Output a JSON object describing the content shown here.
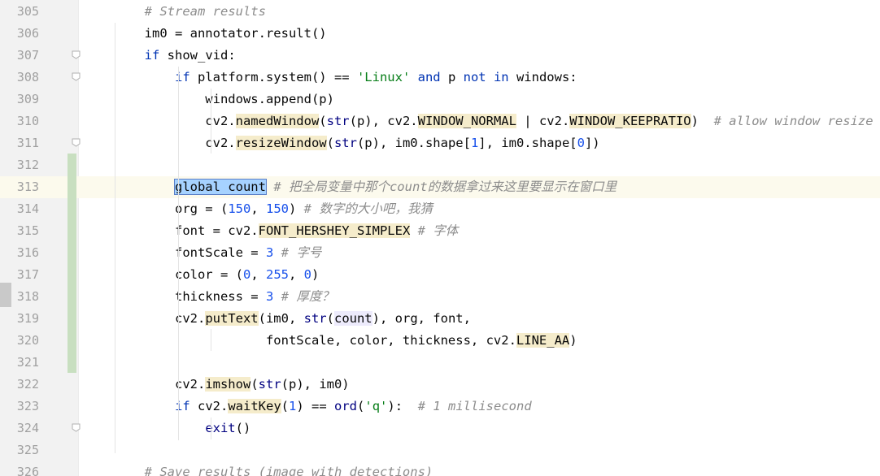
{
  "editor": {
    "lines": [
      {
        "n": "305",
        "segs": [
          {
            "t": "        "
          },
          {
            "t": "# Stream results",
            "c": "cm"
          }
        ]
      },
      {
        "n": "306",
        "segs": [
          {
            "t": "        im0 = annotator.result()"
          }
        ]
      },
      {
        "n": "307",
        "segs": [
          {
            "t": "        "
          },
          {
            "t": "if",
            "c": "kw"
          },
          {
            "t": " show_vid:"
          }
        ]
      },
      {
        "n": "308",
        "segs": [
          {
            "t": "            "
          },
          {
            "t": "if",
            "c": "kw"
          },
          {
            "t": " platform.system() == "
          },
          {
            "t": "'Linux'",
            "c": "str"
          },
          {
            "t": " "
          },
          {
            "t": "and",
            "c": "kw"
          },
          {
            "t": " p "
          },
          {
            "t": "not in",
            "c": "kw"
          },
          {
            "t": " windows:"
          }
        ]
      },
      {
        "n": "309",
        "segs": [
          {
            "t": "                windows.append(p)"
          }
        ]
      },
      {
        "n": "310",
        "segs": [
          {
            "t": "                cv2."
          },
          {
            "t": "namedWindow",
            "c": "fn"
          },
          {
            "t": "("
          },
          {
            "t": "str",
            "c": "bi"
          },
          {
            "t": "(p), cv2."
          },
          {
            "t": "WINDOW_NORMAL",
            "c": "fn"
          },
          {
            "t": " | cv2."
          },
          {
            "t": "WINDOW_KEEPRATIO",
            "c": "fn"
          },
          {
            "t": ")  "
          },
          {
            "t": "# allow window resize (Linux)",
            "c": "cm"
          }
        ]
      },
      {
        "n": "311",
        "segs": [
          {
            "t": "                cv2."
          },
          {
            "t": "resizeWindow",
            "c": "fn"
          },
          {
            "t": "("
          },
          {
            "t": "str",
            "c": "bi"
          },
          {
            "t": "(p), im0.shape["
          },
          {
            "t": "1",
            "c": "num"
          },
          {
            "t": "], im0.shape["
          },
          {
            "t": "0",
            "c": "num"
          },
          {
            "t": "])"
          }
        ]
      },
      {
        "n": "312",
        "segs": [
          {
            "t": ""
          }
        ]
      },
      {
        "n": "313",
        "segs": [
          {
            "t": "            "
          },
          {
            "t": "global count",
            "c": "sel"
          },
          {
            "t": " "
          },
          {
            "t": "# 把全局变量中那个count的数据拿过来这里要显示在窗口里",
            "c": "cm"
          }
        ]
      },
      {
        "n": "314",
        "segs": [
          {
            "t": "            org = ("
          },
          {
            "t": "150",
            "c": "num"
          },
          {
            "t": ", "
          },
          {
            "t": "150",
            "c": "num"
          },
          {
            "t": ") "
          },
          {
            "t": "# 数字的大小吧，我猜",
            "c": "cm"
          }
        ]
      },
      {
        "n": "315",
        "segs": [
          {
            "t": "            font = cv2."
          },
          {
            "t": "FONT_HERSHEY_SIMPLEX",
            "c": "fn"
          },
          {
            "t": " "
          },
          {
            "t": "# 字体",
            "c": "cm"
          }
        ]
      },
      {
        "n": "316",
        "segs": [
          {
            "t": "            fontScale = "
          },
          {
            "t": "3",
            "c": "num"
          },
          {
            "t": " "
          },
          {
            "t": "# 字号",
            "c": "cm"
          }
        ]
      },
      {
        "n": "317",
        "segs": [
          {
            "t": "            color = ("
          },
          {
            "t": "0",
            "c": "num"
          },
          {
            "t": ", "
          },
          {
            "t": "255",
            "c": "num"
          },
          {
            "t": ", "
          },
          {
            "t": "0",
            "c": "num"
          },
          {
            "t": ")"
          }
        ]
      },
      {
        "n": "318",
        "segs": [
          {
            "t": "            thickness = "
          },
          {
            "t": "3",
            "c": "num"
          },
          {
            "t": " "
          },
          {
            "t": "# 厚度？",
            "c": "cm"
          }
        ]
      },
      {
        "n": "319",
        "segs": [
          {
            "t": "            cv2."
          },
          {
            "t": "putText",
            "c": "fn"
          },
          {
            "t": "(im0, "
          },
          {
            "t": "str",
            "c": "bi"
          },
          {
            "t": "("
          },
          {
            "t": "count",
            "c": "cnt"
          },
          {
            "t": "), org, font,"
          }
        ]
      },
      {
        "n": "320",
        "segs": [
          {
            "t": "                        fontScale, color, thickness, cv2."
          },
          {
            "t": "LINE_AA",
            "c": "fn"
          },
          {
            "t": ")"
          }
        ]
      },
      {
        "n": "321",
        "segs": [
          {
            "t": ""
          }
        ]
      },
      {
        "n": "322",
        "segs": [
          {
            "t": "            cv2."
          },
          {
            "t": "imshow",
            "c": "fn"
          },
          {
            "t": "("
          },
          {
            "t": "str",
            "c": "bi"
          },
          {
            "t": "(p), im0)"
          }
        ]
      },
      {
        "n": "323",
        "segs": [
          {
            "t": "            "
          },
          {
            "t": "if",
            "c": "kw"
          },
          {
            "t": " cv2."
          },
          {
            "t": "waitKey",
            "c": "fn"
          },
          {
            "t": "("
          },
          {
            "t": "1",
            "c": "num"
          },
          {
            "t": ") == "
          },
          {
            "t": "ord",
            "c": "bi"
          },
          {
            "t": "("
          },
          {
            "t": "'q'",
            "c": "str"
          },
          {
            "t": "):  "
          },
          {
            "t": "# 1 millisecond",
            "c": "cm"
          }
        ]
      },
      {
        "n": "324",
        "segs": [
          {
            "t": "                "
          },
          {
            "t": "exit",
            "c": "bi"
          },
          {
            "t": "()"
          }
        ]
      },
      {
        "n": "325",
        "segs": [
          {
            "t": ""
          }
        ]
      },
      {
        "n": "326",
        "segs": [
          {
            "t": "        "
          },
          {
            "t": "# Save results (image with detections)",
            "c": "cm"
          }
        ]
      }
    ],
    "current_line": "313",
    "fold_markers": [
      "307",
      "308",
      "311",
      "324"
    ]
  }
}
